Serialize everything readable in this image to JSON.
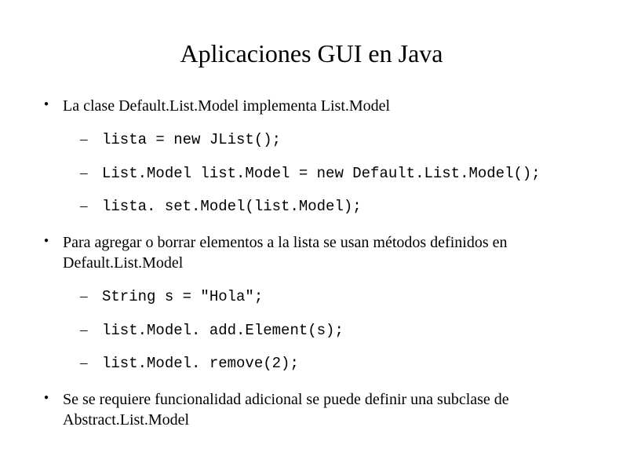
{
  "title": "Aplicaciones GUI en Java",
  "bullets": [
    {
      "text": "La clase Default.List.Model implementa List.Model",
      "subitems": [
        "lista = new JList();",
        "List.Model list.Model = new Default.List.Model();",
        "lista. set.Model(list.Model);"
      ]
    },
    {
      "text": "Para agregar o borrar elementos a la lista se usan métodos definidos en Default.List.Model",
      "subitems": [
        "String s = \"Hola\";",
        "list.Model. add.Element(s);",
        "list.Model. remove(2);"
      ]
    },
    {
      "text": "Se se requiere funcionalidad adicional se puede definir una subclase de Abstract.List.Model",
      "subitems": []
    }
  ]
}
